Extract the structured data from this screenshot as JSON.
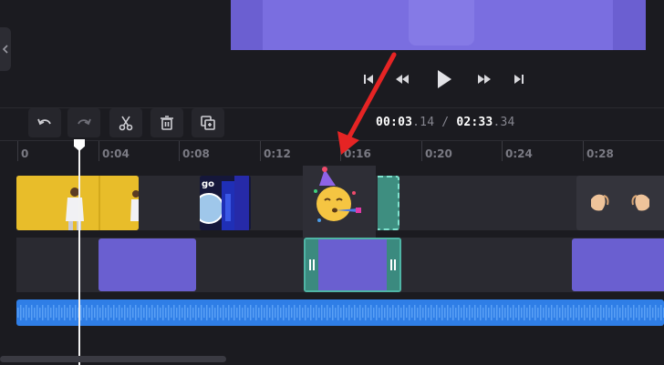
{
  "colors": {
    "accent": "#6a5fd0",
    "selected_clip_border": "#4fb5a5",
    "audio": "#2f7ee6",
    "annotation_arrow": "#e62424"
  },
  "player": {
    "controls": [
      "skip-to-start-icon",
      "rewind-icon",
      "play-icon",
      "fast-forward-icon",
      "skip-to-end-icon"
    ]
  },
  "toolbar": {
    "tools": [
      "undo-icon",
      "redo-icon",
      "split-icon",
      "delete-icon",
      "duplicate-icon"
    ],
    "time": {
      "current_main": "00:03",
      "current_frac": ".14",
      "separator": "/",
      "total_main": "02:33",
      "total_frac": ".34"
    }
  },
  "ruler": {
    "ticks": [
      "0",
      "0:04",
      "0:08",
      "0:12",
      "0:16",
      "0:20",
      "0:24",
      "0:28"
    ]
  },
  "tracks": {
    "video": {
      "clips": [
        "woman-yellow-wall",
        "dark-graphic",
        "party-emoji",
        "hands-emoji"
      ],
      "graphic_text": "go"
    },
    "overlay": {
      "clips": [
        "purple-block",
        "selected-purple-block",
        "purple-block-right"
      ]
    },
    "audio": {
      "clip": "audio-waveform"
    }
  },
  "annotation": {
    "type": "red-arrow"
  }
}
